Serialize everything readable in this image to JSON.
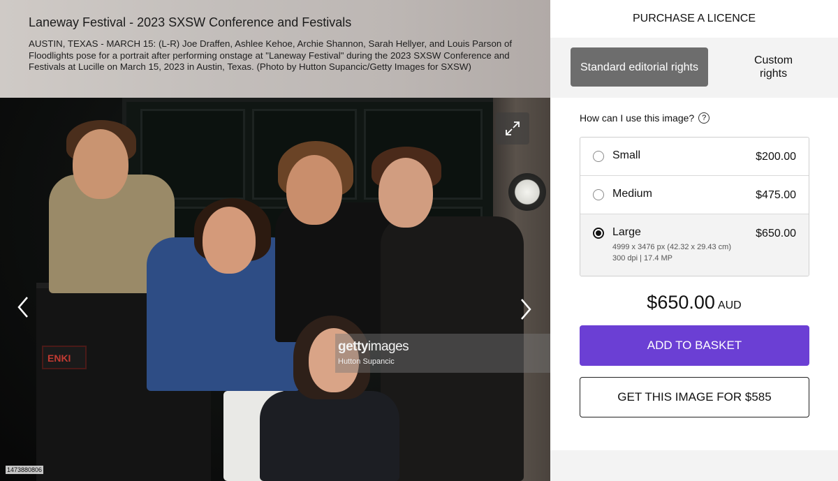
{
  "image": {
    "title": "Laneway Festival - 2023 SXSW Conference and Festivals",
    "caption": "AUSTIN, TEXAS - MARCH 15: (L-R) Joe Draffen, Ashlee Kehoe, Archie Shannon, Sarah Hellyer, and Louis Parson of Floodlights pose for a portrait after performing onstage at \"Laneway Festival\" during the 2023 SXSW Conference and Festivals at Lucille on March 15, 2023 in Austin, Texas. (Photo by Hutton Supancic/Getty Images for SXSW)",
    "watermark_brand_bold": "getty",
    "watermark_brand_light": "images",
    "watermark_credit": "Hutton Supancic",
    "image_id": "1473880806",
    "crate_logo_text": "ENKI"
  },
  "panel": {
    "header": "PURCHASE A LICENCE",
    "tabs": [
      {
        "label": "Standard editorial rights",
        "active": true
      },
      {
        "label": "Custom rights",
        "active": false
      }
    ],
    "question": "How can I use this image?",
    "help_icon_glyph": "?",
    "options": [
      {
        "name": "Small",
        "price": "$200.00",
        "selected": false
      },
      {
        "name": "Medium",
        "price": "$475.00",
        "selected": false
      },
      {
        "name": "Large",
        "price": "$650.00",
        "selected": true,
        "detail_line1": "4999 x 3476 px (42.32 x 29.43 cm)",
        "detail_line2": "300 dpi | 17.4 MP"
      }
    ],
    "total_amount": "$650.00",
    "total_currency": "AUD",
    "add_to_basket": "ADD TO BASKET",
    "get_image": "GET THIS IMAGE FOR $585"
  },
  "colors": {
    "accent_purple": "#6b3fd4",
    "active_tab": "#6d6d6d",
    "panel_gray": "#f3f3f3"
  },
  "icons": [
    "expand-icon",
    "chevron-left-icon",
    "chevron-right-icon",
    "help-icon",
    "radio-icon"
  ]
}
